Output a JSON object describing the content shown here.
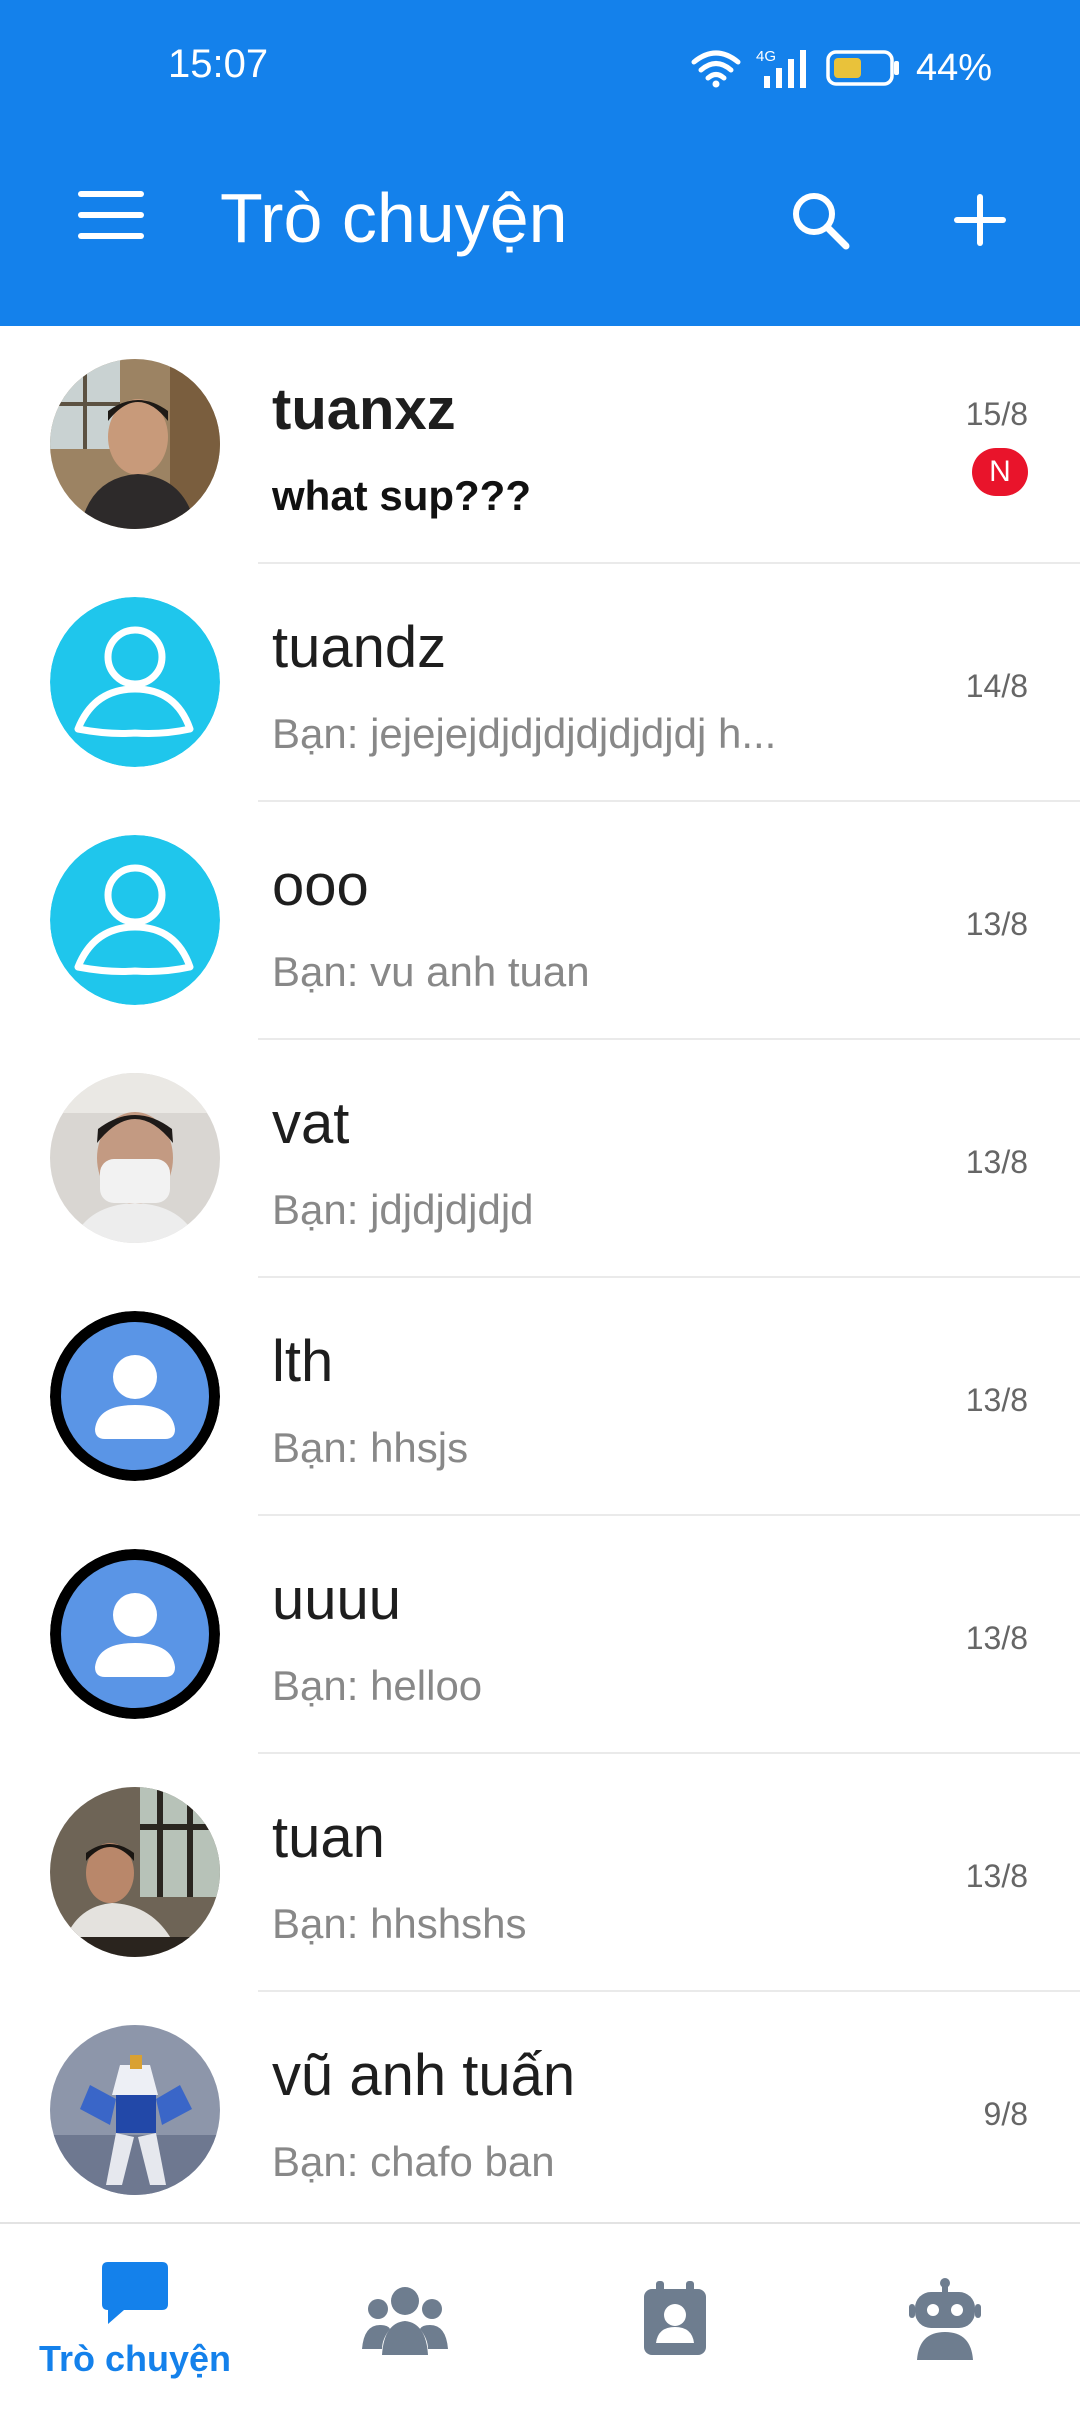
{
  "status_bar": {
    "time": "15:07",
    "network": "4G",
    "battery": "44%"
  },
  "header": {
    "title": "Trò chuyện"
  },
  "conversations": [
    {
      "name": "tuanxz",
      "preview": "what sup???",
      "date": "15/8",
      "badge": "N",
      "unread": true
    },
    {
      "name": "tuandz",
      "preview": "Bạn:  jejejejdjdjdjdjdjdjdj h...",
      "date": "14/8"
    },
    {
      "name": "ooo",
      "preview": "Bạn:  vu anh tuan",
      "date": "13/8"
    },
    {
      "name": "vat",
      "preview": "Bạn:  jdjdjdjdjd",
      "date": "13/8"
    },
    {
      "name": "lth",
      "preview": "Bạn:  hhsjs",
      "date": "13/8"
    },
    {
      "name": "uuuu",
      "preview": "Bạn:  helloo",
      "date": "13/8"
    },
    {
      "name": "tuan",
      "preview": "Bạn:  hhshshs",
      "date": "13/8"
    },
    {
      "name": "vũ anh tuấn",
      "preview": "Bạn:  chafo ban",
      "date": "9/8"
    }
  ],
  "bottom_nav": {
    "chat_label": "Trò chuyện",
    "items": [
      "chat-icon",
      "groups-icon",
      "contacts-icon",
      "bot-icon"
    ]
  },
  "colors": {
    "brand": "#1481EB",
    "badge": "#E9142B",
    "default_avatar_cyan": "#1FC6EC",
    "default_avatar_blue": "#5A95E6",
    "nav_inactive": "#6E7D8F"
  }
}
